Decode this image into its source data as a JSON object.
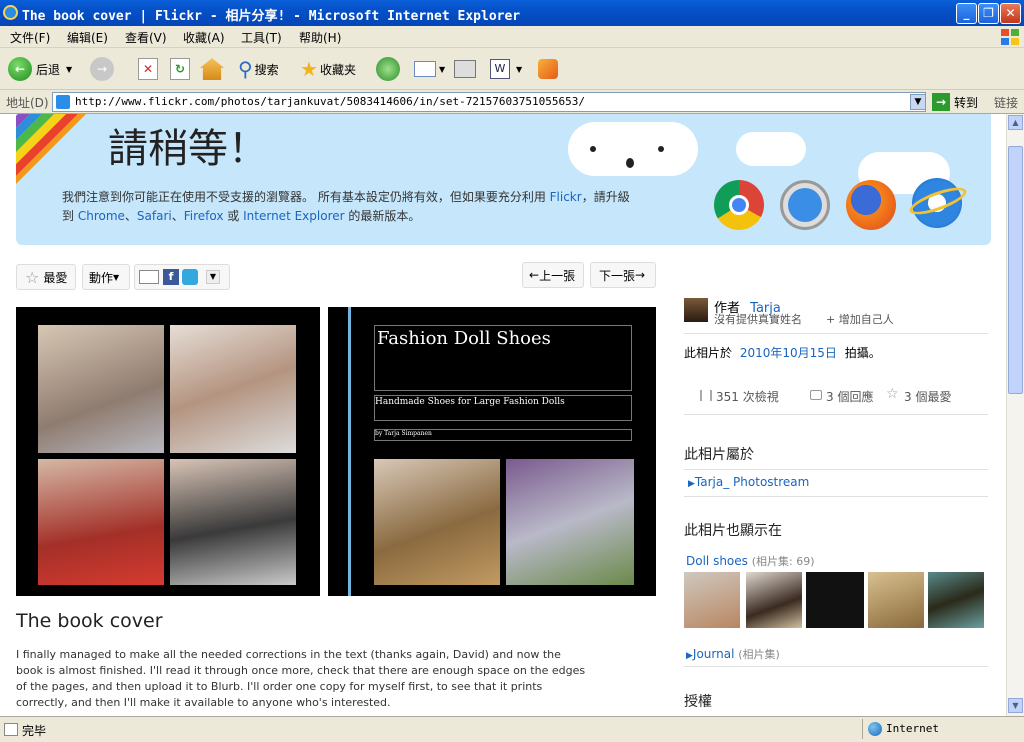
{
  "window": {
    "title": "The book cover | Flickr - 相片分享! - Microsoft Internet Explorer",
    "min": "_",
    "max": "❐",
    "close": "✕"
  },
  "menu": [
    "文件(F)",
    "编辑(E)",
    "查看(V)",
    "收藏(A)",
    "工具(T)",
    "帮助(H)"
  ],
  "toolbar": {
    "back": "后退",
    "search": "搜索",
    "favorites": "收藏夹"
  },
  "address": {
    "label": "地址(D)",
    "url": "http://www.flickr.com/photos/tarjankuvat/5083414606/in/set-72157603751055653/",
    "go": "转到",
    "links": "链接"
  },
  "banner": {
    "title": "請稍等！",
    "line1_pre": "我們注意到你可能正在使用不受支援的瀏覽器。 所有基本設定仍將有效，但如果要充分利用 ",
    "line1_link": "Flickr",
    "line1_post": "，請升級",
    "line2_pre": "到 ",
    "chrome": "Chrome",
    "sep1": "、",
    "safari": "Safari",
    "sep2": "、",
    "firefox": "Firefox",
    "or": " 或 ",
    "ie": "Internet Explorer",
    "line2_post": " 的最新版本。"
  },
  "actions": {
    "fave": "最愛",
    "actions": "動作",
    "prev": "上一張",
    "next": "下一張"
  },
  "photo": {
    "book_title": "Fashion Doll Shoes",
    "book_subtitle": "Handmade Shoes for Large Fashion Dolls",
    "book_author": "by Tarja Simpanen"
  },
  "title": "The book cover",
  "description": "I finally managed to make all the needed corrections in the text (thanks again, David) and now the book is almost finished. I'll read it through once more, check that there are enough space on the edges of the pages, and then upload it to Blurb. I'll order one copy for myself first, to see that it prints correctly, and then I'll make it available to anyone who's interested.",
  "sidebar": {
    "by_label": "作者",
    "author": "Tarja",
    "no_real_name": "沒有提供真實姓名",
    "add_self": "+ 增加自己人",
    "taken_pre": "此相片於",
    "taken_date": "2010年10月15日",
    "taken_post": "拍攝。",
    "views": "351 次檢視",
    "comments": "3 個回應",
    "faves": "3 個最愛",
    "belongs_heading": "此相片屬於",
    "photostream": "Tarja_ Photostream",
    "also_in_heading": "此相片也顯示在",
    "set1_name": "Doll shoes",
    "set1_meta": "(相片集: 69)",
    "set2_name": "Journal",
    "set2_meta": "(相片集)",
    "license_heading": "授權"
  },
  "status": {
    "done": "完毕",
    "zone": "Internet"
  },
  "colors": {
    "link": "#1a65c0",
    "banner_bg": "#c5e6fb",
    "titlebar": "#0550c8"
  }
}
